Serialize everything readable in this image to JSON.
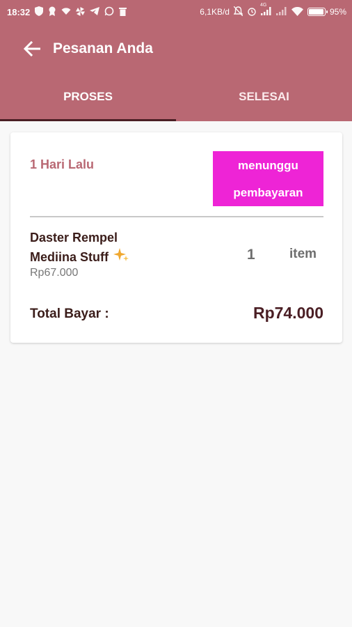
{
  "status_bar": {
    "time": "18:32",
    "net_speed": "6,1KB/d",
    "network_label": "4G",
    "battery": "95%",
    "battery_level": 0.95
  },
  "app_bar": {
    "title": "Pesanan Anda",
    "back_icon": "arrow-left-icon"
  },
  "tabs": [
    {
      "label": "PROSES",
      "active": true
    },
    {
      "label": "SELESAI",
      "active": false
    }
  ],
  "order": {
    "time_ago": "1 Hari Lalu",
    "status_line1": "menunggu",
    "status_line2": "pembayaran",
    "product_name_line1": "Daster Rempel",
    "product_name_line2": "Mediina Stuff",
    "product_icon": "sparkle-icon",
    "product_price": "Rp67.000",
    "quantity": "1",
    "quantity_unit": "item",
    "total_label": "Total Bayar :",
    "total_value": "Rp74.000"
  },
  "colors": {
    "header": "#b96873",
    "tab_indicator": "#4a1e24",
    "status_badge": "#ee24d6",
    "time_ago": "#b96873",
    "text_dark": "#3b1d1a"
  }
}
